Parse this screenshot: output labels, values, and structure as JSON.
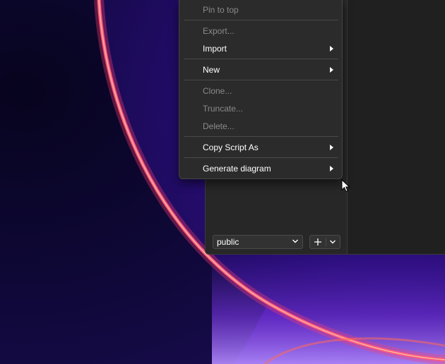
{
  "context_menu": {
    "items": [
      {
        "label": "Pin to top",
        "enabled": false,
        "submenu": false
      },
      {
        "label": "Export...",
        "enabled": false,
        "submenu": false
      },
      {
        "label": "Import",
        "enabled": true,
        "submenu": true
      },
      {
        "label": "New",
        "enabled": true,
        "submenu": true
      },
      {
        "label": "Clone...",
        "enabled": false,
        "submenu": false
      },
      {
        "label": "Truncate...",
        "enabled": false,
        "submenu": false
      },
      {
        "label": "Delete...",
        "enabled": false,
        "submenu": false
      },
      {
        "label": "Copy Script As",
        "enabled": true,
        "submenu": true
      },
      {
        "label": "Generate diagram",
        "enabled": true,
        "submenu": true
      }
    ]
  },
  "schema_selector": {
    "value": "public"
  },
  "icons": {
    "schema_dropdown": "chevron-down-icon",
    "add": "plus-icon",
    "add_dropdown": "chevron-down-icon",
    "submenu": "chevron-right-icon",
    "cursor": "mouse-pointer-icon"
  },
  "colors": {
    "menu_background": "#2b2b2b",
    "menu_text": "#ffffff",
    "menu_text_disabled": "#8a8a8a",
    "panel_background": "#272727",
    "wallpaper_base": "#0c0730",
    "wallpaper_glow": "#ff3d6e"
  }
}
